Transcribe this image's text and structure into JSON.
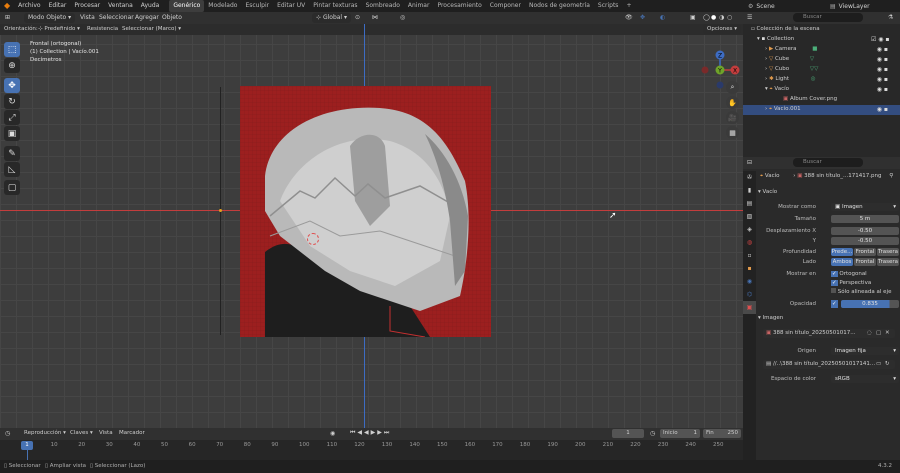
{
  "topbar": {
    "menus": [
      "Archivo",
      "Editar",
      "Procesar",
      "Ventana",
      "Ayuda"
    ],
    "workspaces": [
      "Genérico",
      "Modelado",
      "Esculpir",
      "Editar UV",
      "Pintar texturas",
      "Sombreado",
      "Animar",
      "Procesamiento",
      "Componer",
      "Nodos de geometría",
      "Scripts"
    ],
    "active_workspace": "Genérico",
    "scene": "Scene",
    "viewlayer": "ViewLayer"
  },
  "viewport_header": {
    "mode": "Modo Objeto",
    "menus": [
      "Vista",
      "Seleccionar",
      "Agregar",
      "Objeto"
    ],
    "transform_orientation": "Global",
    "search_placeholder": "Buscar"
  },
  "tool_header": {
    "orientation_label": "Orientación:",
    "orientation_value": "Predefinido",
    "drag_label": "Resistencia",
    "drag_value": "Seleccionar (Marco)",
    "options": "Opciones"
  },
  "overlay_text": {
    "line1": "Frontal (ortogonal)",
    "line2": "(1) Collection | Vacío.001",
    "line3": "Decímetros"
  },
  "gizmo": {
    "z": "Z",
    "y": "Y",
    "x": "X"
  },
  "outliner": {
    "title": "Colección de la escena",
    "items": [
      {
        "name": "Collection",
        "level": 0,
        "icon": "collection-icon"
      },
      {
        "name": "Camera",
        "level": 1,
        "icon": "camera-icon"
      },
      {
        "name": "Cube",
        "level": 1,
        "icon": "mesh-icon"
      },
      {
        "name": "Cubo",
        "level": 1,
        "icon": "mesh-icon"
      },
      {
        "name": "Light",
        "level": 1,
        "icon": "light-icon"
      },
      {
        "name": "Vacío",
        "level": 1,
        "icon": "empty-icon"
      },
      {
        "name": "Album Cover.png",
        "level": 2,
        "icon": "image-icon"
      },
      {
        "name": "Vacío.001",
        "level": 1,
        "icon": "empty-icon"
      }
    ]
  },
  "properties": {
    "search_placeholder": "Buscar",
    "breadcrumb_object": "Vacío",
    "breadcrumb_image": "388 sin título_...171417.png",
    "section_empty": "Vacío",
    "display_as_label": "Mostrar como",
    "display_as_value": "Imagen",
    "size_label": "Tamaño",
    "size_value": "5 m",
    "offset_x_label": "Desplazamiento X",
    "offset_x_value": "-0.50",
    "offset_y_label": "Y",
    "offset_y_value": "-0.50",
    "depth_label": "Profundidad",
    "depth_options": [
      "Prede...",
      "Frontal",
      "Trasera"
    ],
    "side_label": "Lado",
    "side_options": [
      "Ambos",
      "Frontal",
      "Trasera"
    ],
    "show_in_label": "Mostrar en",
    "show_ortho": "Ortogonal",
    "show_persp": "Perspectiva",
    "show_aligned": "Sólo alineada al eje",
    "opacity_label": "Opacidad",
    "opacity_value": "0.835",
    "section_image": "Imagen",
    "image_name": "388 sin título_20250501017...",
    "source_label": "Origen",
    "source_value": "Imagen fija",
    "filepath": "//..\\388 sin título_20250501017141...",
    "colorspace_label": "Espacio de color",
    "colorspace_value": "sRGB"
  },
  "timeline": {
    "menus": [
      "Reproducción",
      "Claves",
      "Vista",
      "Marcador"
    ],
    "current_frame": "1",
    "start_label": "Inicio",
    "start": "1",
    "end_label": "Fin",
    "end": "250",
    "ruler": [
      "0",
      "10",
      "20",
      "30",
      "40",
      "50",
      "60",
      "70",
      "80",
      "90",
      "100",
      "110",
      "120",
      "130",
      "140",
      "150",
      "160",
      "170",
      "180",
      "190",
      "200",
      "210",
      "220",
      "230",
      "240",
      "250"
    ]
  },
  "status": {
    "items": [
      "Seleccionar",
      "Ampliar vista",
      "Seleccionar (Lazo)"
    ],
    "version": "4.3.2"
  },
  "colors": {
    "accent": "#4772b3",
    "red_backdrop": "#9c1f1f",
    "x_axis": "#c33d3d",
    "y_axis": "#6fa32a",
    "z_axis": "#3d6cc3"
  }
}
